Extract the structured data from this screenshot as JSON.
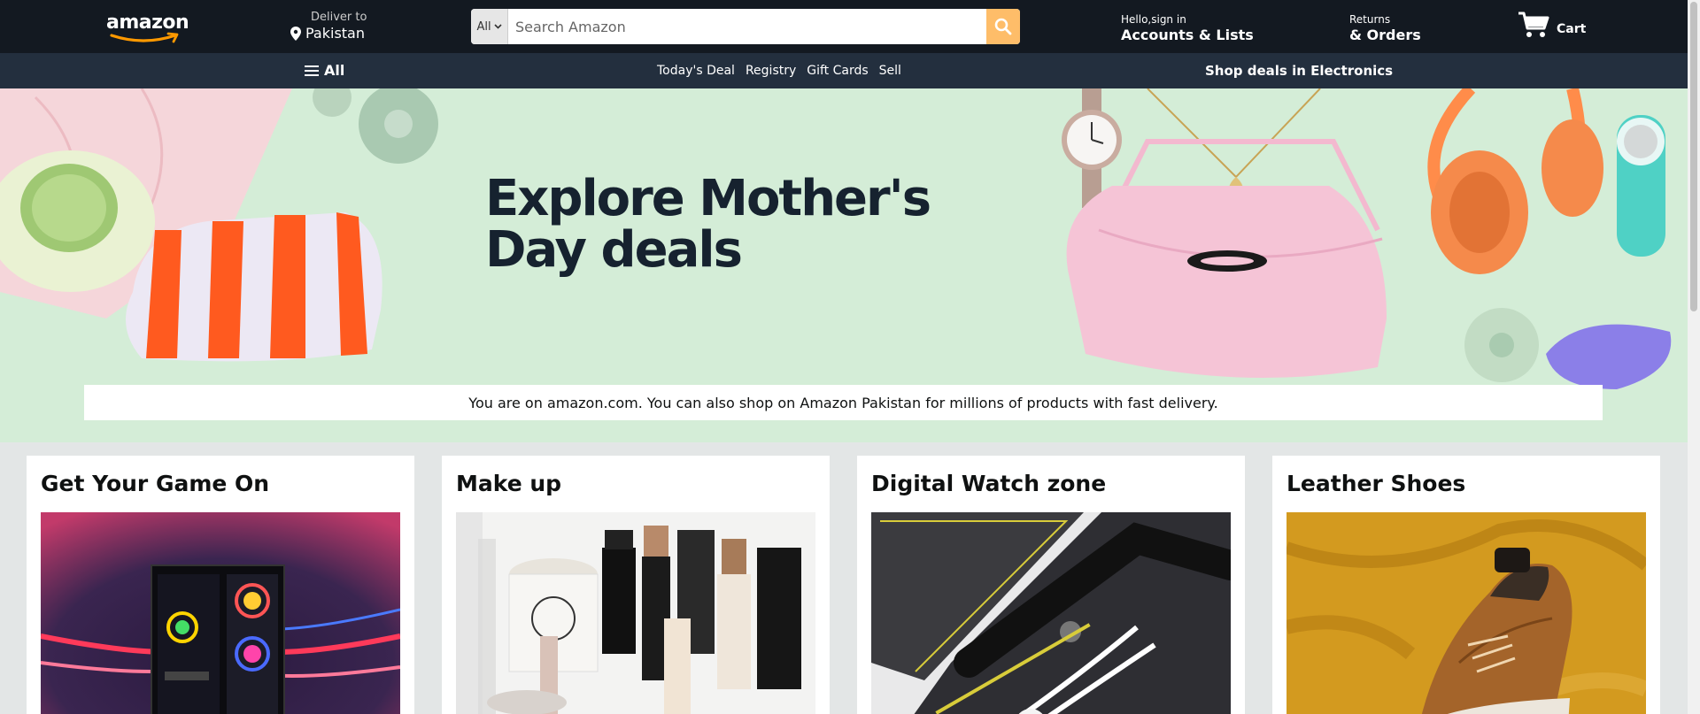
{
  "header": {
    "logo": "amazon",
    "deliver_to": "Deliver to",
    "location": "Pakistan",
    "search": {
      "category": "All",
      "placeholder": "Search Amazon"
    },
    "signin_line1": "Hello,sign in",
    "signin_line2": "Accounts & Lists",
    "returns_line1": "Returns",
    "returns_line2": "& Orders",
    "cart_label": "Cart"
  },
  "subnav": {
    "all_label": "All",
    "links": [
      "Today's Deal",
      "Registry",
      "Gift Cards",
      "Sell"
    ],
    "promo": "Shop deals in Electronics"
  },
  "hero": {
    "title_line1": "Explore Mother's",
    "title_line2": "Day deals",
    "notice": "You are on amazon.com. You can also shop on Amazon Pakistan for millions of products with fast delivery."
  },
  "cards": [
    {
      "title": "Get Your Game On"
    },
    {
      "title": "Make up"
    },
    {
      "title": "Digital Watch zone"
    },
    {
      "title": "Leather Shoes"
    }
  ],
  "colors": {
    "topnav_bg": "#131921",
    "subnav_bg": "#232f3e",
    "search_button": "#febd69",
    "hero_bg": "#d4edd7",
    "page_bg": "#e3e6e6"
  },
  "icons": [
    "location-pin-icon",
    "chevron-down-icon",
    "search-icon",
    "cart-icon",
    "hamburger-icon"
  ]
}
